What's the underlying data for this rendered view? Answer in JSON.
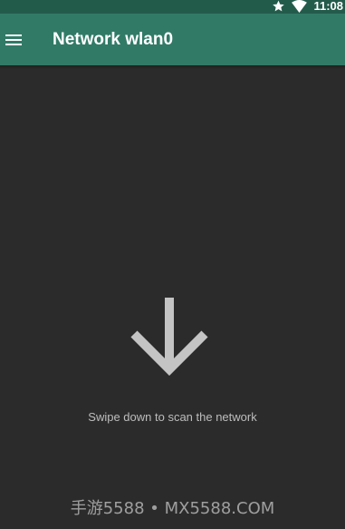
{
  "status_bar": {
    "time": "11:08",
    "icons": [
      "star-icon",
      "wifi-icon"
    ]
  },
  "app_bar": {
    "menu_icon": "menu-icon",
    "title": "Network wlan0"
  },
  "empty_state": {
    "icon": "arrow-down-icon",
    "hint": "Swipe down to scan the network"
  },
  "watermark": {
    "text": "手游5588 • MX5588.COM"
  },
  "colors": {
    "status_bar": "#235b4b",
    "app_bar": "#317a66",
    "background": "#2b2b2b",
    "arrow": "#c4c4c4",
    "hint_text": "#bdbdbd"
  }
}
